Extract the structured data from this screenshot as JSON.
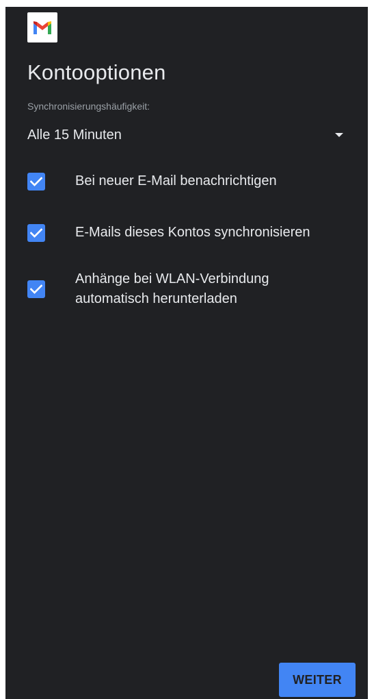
{
  "app": {
    "logo_icon": "gmail-logo-icon"
  },
  "screen": {
    "title": "Kontooptionen",
    "sync_label": "Synchronisierungshäufigkeit:",
    "sync_dropdown": {
      "selected": "Alle 15 Minuten",
      "icon": "dropdown-arrow-icon"
    },
    "options": [
      {
        "label_lines": [
          "Bei neuer E-Mail benachrichtigen"
        ],
        "checked": true
      },
      {
        "label_lines": [
          "E-Mails dieses Kontos synchronisieren"
        ],
        "checked": true
      },
      {
        "label_lines": [
          "Anhänge bei WLAN-Verbindung",
          "automatisch herunterladen"
        ],
        "checked": true
      }
    ],
    "next_button": "WEITER"
  },
  "colors": {
    "background": "#202124",
    "accent": "#4285f4",
    "text_primary": "#e8eaed",
    "text_secondary": "#9aa0a6"
  }
}
